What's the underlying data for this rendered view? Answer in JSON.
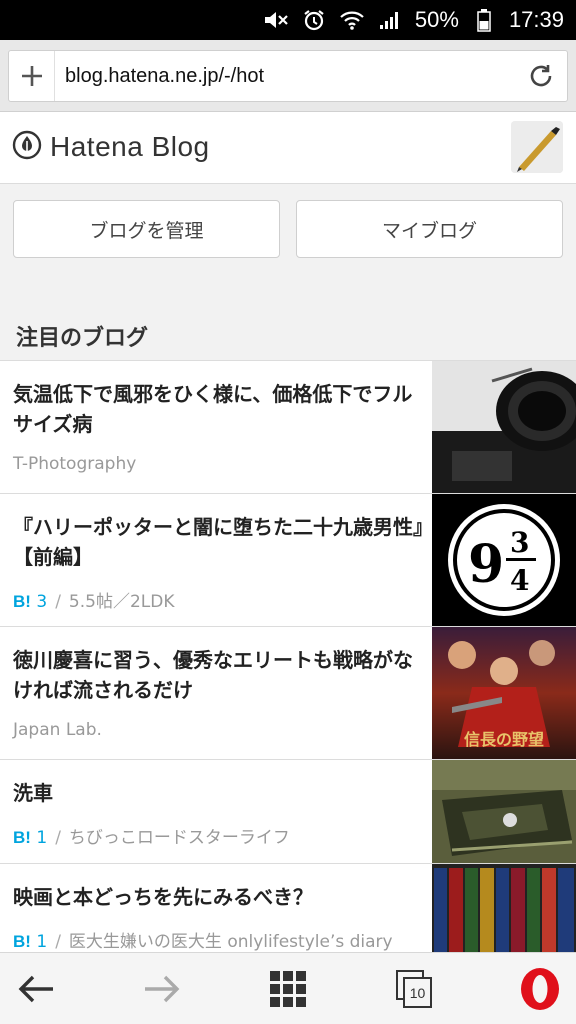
{
  "status_bar": {
    "battery": "50%",
    "time": "17:39",
    "icons": [
      "mute-icon",
      "alarm-icon",
      "wifi-icon",
      "signal-icon",
      "battery-icon"
    ]
  },
  "address_bar": {
    "url": "blog.hatena.ne.jp/-/hot",
    "icons": [
      "plus-icon",
      "reload-icon"
    ]
  },
  "header": {
    "logo_text": "Hatena Blog",
    "icons": [
      "hatena-logo-icon",
      "avatar"
    ]
  },
  "buttons": {
    "manage": "ブログを管理",
    "my_blog": "マイブログ"
  },
  "section": {
    "title": "注目のブログ"
  },
  "entries": [
    {
      "title": "気温低下で風邪をひく様に、価格低下でフルサイズ病",
      "bookmark_label": "",
      "bookmark_count": "",
      "blog_name": "T-Photography",
      "thumb": "camera"
    },
    {
      "title": "『ハリーポッターと闇に堕ちた二十九歳男性』【前編】",
      "bookmark_label": "B!",
      "bookmark_count": "3",
      "blog_name": "5.5帖／2LDK",
      "thumb": "platform-sign"
    },
    {
      "title": "徳川慶喜に習う、優秀なエリートも戦略がなければ流されるだけ",
      "bookmark_label": "",
      "bookmark_count": "",
      "blog_name": "Japan Lab.",
      "thumb": "game-art",
      "thumb_text": "信長の野望"
    },
    {
      "title": "洗車",
      "bookmark_label": "B!",
      "bookmark_count": "1",
      "blog_name": "ちびっこロードスターライフ",
      "thumb": "car"
    },
    {
      "title": "映画と本どっちを先にみるべき？",
      "bookmark_label": "B!",
      "bookmark_count": "1",
      "blog_name": "医大生嫌いの医大生 onlylifestyle’s diary",
      "thumb": "books"
    }
  ],
  "bottom_bar": {
    "tab_count": "10",
    "icons": [
      "back-arrow-icon",
      "forward-arrow-icon",
      "speed-dial-grid-icon",
      "tabs-icon",
      "opera-logo-icon"
    ]
  },
  "colors": {
    "accent_bookmark": "#00a4de",
    "opera_red": "#e0101b"
  }
}
